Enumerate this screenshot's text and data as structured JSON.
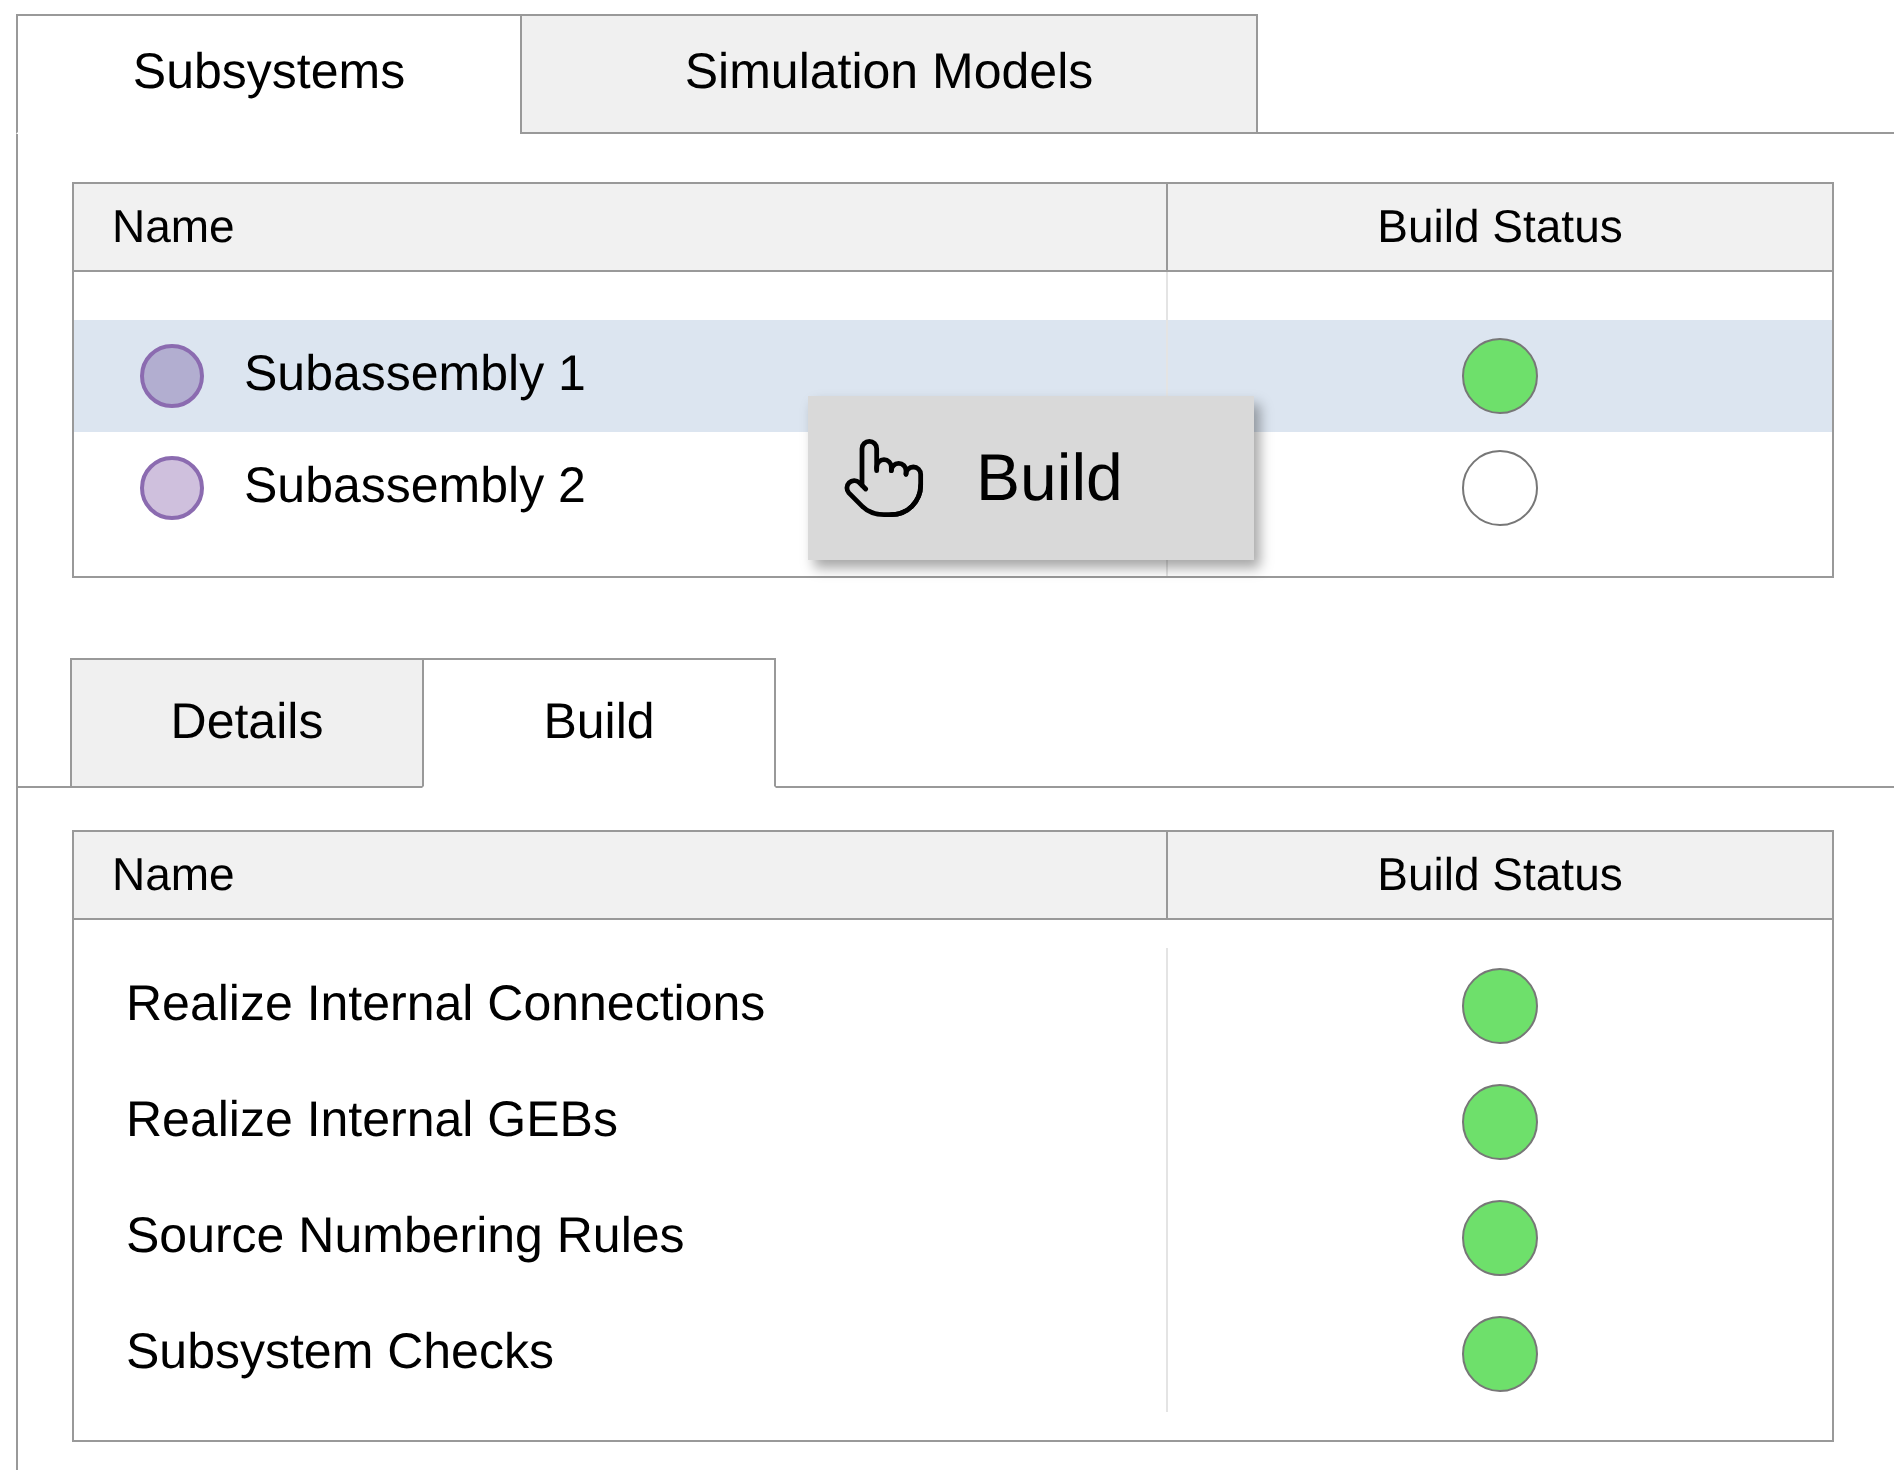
{
  "top_tabs": [
    {
      "label": "Subsystems",
      "selected": true
    },
    {
      "label": "Simulation Models",
      "selected": false
    }
  ],
  "subsystems_table": {
    "columns": [
      "Name",
      "Build Status"
    ],
    "rows": [
      {
        "name": "Subassembly 1",
        "selected": true,
        "built": true
      },
      {
        "name": "Subassembly 2",
        "selected": false,
        "built": false
      }
    ]
  },
  "context_menu": {
    "items": [
      {
        "label": "Build"
      }
    ]
  },
  "bottom_tabs": [
    {
      "label": "Details",
      "selected": false
    },
    {
      "label": "Build",
      "selected": true
    }
  ],
  "build_table": {
    "columns": [
      "Name",
      "Build Status"
    ],
    "rows": [
      {
        "name": "Realize Internal Connections",
        "built": true
      },
      {
        "name": "Realize Internal GEBs",
        "built": true
      },
      {
        "name": "Source Numbering Rules",
        "built": true
      },
      {
        "name": "Subsystem Checks",
        "built": true
      }
    ]
  }
}
